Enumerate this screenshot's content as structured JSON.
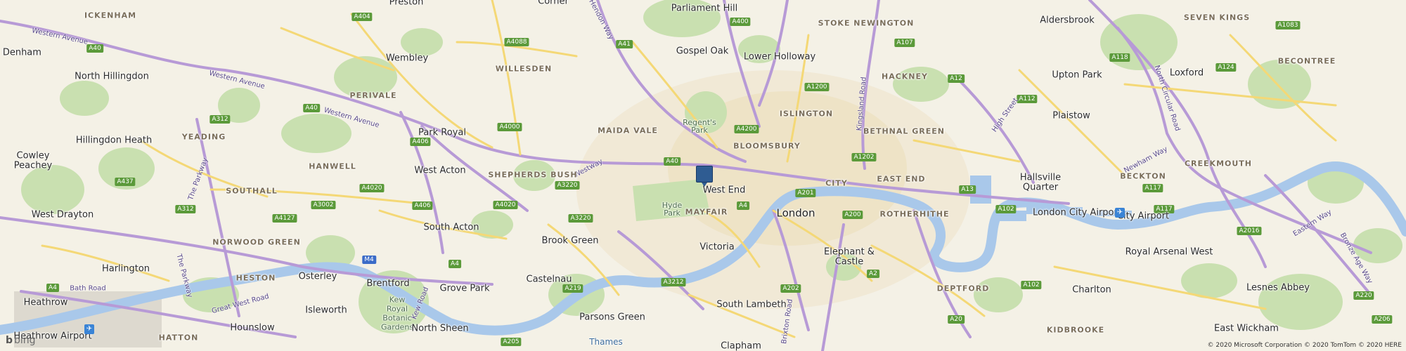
{
  "map": {
    "pin_label": "West End",
    "places": [
      {
        "id": "ickenham",
        "text": "ICKENHAM",
        "kind": "district"
      },
      {
        "id": "preston",
        "text": "Preston",
        "kind": "town"
      },
      {
        "id": "parliament-hill",
        "text": "Parliament Hill",
        "kind": "town"
      },
      {
        "id": "stoke-newington",
        "text": "STOKE NEWINGTON",
        "kind": "district"
      },
      {
        "id": "aldersbrook",
        "text": "Aldersbrook",
        "kind": "town"
      },
      {
        "id": "seven-kings",
        "text": "SEVEN KINGS",
        "kind": "district"
      },
      {
        "id": "new-denham",
        "text": "ew Denham",
        "kind": "town"
      },
      {
        "id": "north-hillingdon",
        "text": "North Hillingdon",
        "kind": "town"
      },
      {
        "id": "wembley",
        "text": "Wembley",
        "kind": "town"
      },
      {
        "id": "willesden",
        "text": "WILLESDEN",
        "kind": "district"
      },
      {
        "id": "gospel-oak",
        "text": "Gospel Oak",
        "kind": "town"
      },
      {
        "id": "lower-holloway",
        "text": "Lower Holloway",
        "kind": "town"
      },
      {
        "id": "hackney",
        "text": "HACKNEY",
        "kind": "district"
      },
      {
        "id": "upton-park",
        "text": "Upton Park",
        "kind": "town"
      },
      {
        "id": "loxford",
        "text": "Loxford",
        "kind": "town"
      },
      {
        "id": "becontree",
        "text": "BECONTREE",
        "kind": "district"
      },
      {
        "id": "perivale",
        "text": "PERIVALE",
        "kind": "district"
      },
      {
        "id": "islington",
        "text": "ISLINGTON",
        "kind": "district"
      },
      {
        "id": "plaistow",
        "text": "Plaistow",
        "kind": "town"
      },
      {
        "id": "maida-vale",
        "text": "MAIDA VALE",
        "kind": "district"
      },
      {
        "id": "regents-park",
        "text": "Regent's Park",
        "kind": "park"
      },
      {
        "id": "bethnal-green",
        "text": "BETHNAL GREEN",
        "kind": "district"
      },
      {
        "id": "hillingdon-heath",
        "text": "Hillingdon Heath",
        "kind": "town"
      },
      {
        "id": "yeading",
        "text": "YEADING",
        "kind": "district"
      },
      {
        "id": "park-royal",
        "text": "Park Royal",
        "kind": "town"
      },
      {
        "id": "bloomsbury",
        "text": "BLOOMSBURY",
        "kind": "district"
      },
      {
        "id": "cowley",
        "text": "Cowley",
        "kind": "town"
      },
      {
        "id": "peachey",
        "text": "Peachey",
        "kind": "town"
      },
      {
        "id": "hanwell",
        "text": "HANWELL",
        "kind": "district"
      },
      {
        "id": "west-acton",
        "text": "West Acton",
        "kind": "town"
      },
      {
        "id": "shepherds-bush",
        "text": "SHEPHERDS BUSH",
        "kind": "district"
      },
      {
        "id": "city",
        "text": "CITY",
        "kind": "district"
      },
      {
        "id": "east-end",
        "text": "EAST END",
        "kind": "district"
      },
      {
        "id": "hallsville",
        "text": "Hallsville",
        "kind": "town"
      },
      {
        "id": "quarter",
        "text": "Quarter",
        "kind": "town"
      },
      {
        "id": "creekmouth",
        "text": "CREEKMOUTH",
        "kind": "district"
      },
      {
        "id": "southall",
        "text": "SOUTHALL",
        "kind": "district"
      },
      {
        "id": "west-end",
        "text": "West End",
        "kind": "town"
      },
      {
        "id": "beckton",
        "text": "BECKTON",
        "kind": "district"
      },
      {
        "id": "west-drayton",
        "text": "West Drayton",
        "kind": "town"
      },
      {
        "id": "hyde-park",
        "text": "Hyde Park",
        "kind": "park"
      },
      {
        "id": "mayfair",
        "text": "MAYFAIR",
        "kind": "district"
      },
      {
        "id": "london",
        "text": "London",
        "kind": "major"
      },
      {
        "id": "rotherhithe",
        "text": "ROTHERHITHE",
        "kind": "district"
      },
      {
        "id": "london-city-airport",
        "text": "London City Airport",
        "kind": "town"
      },
      {
        "id": "city-airport",
        "text": "City Airport",
        "kind": "town"
      },
      {
        "id": "south-acton",
        "text": "South Acton",
        "kind": "town"
      },
      {
        "id": "norwood-green",
        "text": "NORWOOD GREEN",
        "kind": "district"
      },
      {
        "id": "brook-green",
        "text": "Brook Green",
        "kind": "town"
      },
      {
        "id": "victoria",
        "text": "Victoria",
        "kind": "town"
      },
      {
        "id": "elephant-castle",
        "text": "Elephant &",
        "kind": "town"
      },
      {
        "id": "castle",
        "text": "Castle",
        "kind": "town"
      },
      {
        "id": "royal-arsenal-west",
        "text": "Royal Arsenal West",
        "kind": "town"
      },
      {
        "id": "harlington",
        "text": "Harlington",
        "kind": "town"
      },
      {
        "id": "heston",
        "text": "HESTON",
        "kind": "district"
      },
      {
        "id": "osterley",
        "text": "Osterley",
        "kind": "town"
      },
      {
        "id": "brentford",
        "text": "Brentford",
        "kind": "town"
      },
      {
        "id": "castelnau",
        "text": "Castelnau",
        "kind": "town"
      },
      {
        "id": "grove-park",
        "text": "Grove Park",
        "kind": "town"
      },
      {
        "id": "deptford",
        "text": "DEPTFORD",
        "kind": "district"
      },
      {
        "id": "charlton",
        "text": "Charlton",
        "kind": "town"
      },
      {
        "id": "lesnes-abbey",
        "text": "Lesnes Abbey",
        "kind": "town"
      },
      {
        "id": "kew",
        "text": "Kew",
        "kind": "park"
      },
      {
        "id": "royal",
        "text": "Royal",
        "kind": "park"
      },
      {
        "id": "botanic",
        "text": "Botanic",
        "kind": "park"
      },
      {
        "id": "gardens",
        "text": "Gardens",
        "kind": "park"
      },
      {
        "id": "heathrow",
        "text": "Heathrow",
        "kind": "town"
      },
      {
        "id": "isleworth",
        "text": "Isleworth",
        "kind": "town"
      },
      {
        "id": "parsons-green",
        "text": "Parsons Green",
        "kind": "town"
      },
      {
        "id": "south-lambeth",
        "text": "South Lambeth",
        "kind": "town"
      },
      {
        "id": "hounslow",
        "text": "Hounslow",
        "kind": "town"
      },
      {
        "id": "north-sheen",
        "text": "North Sheen",
        "kind": "town"
      },
      {
        "id": "heathrow-airport",
        "text": "Heathrow Airport",
        "kind": "town"
      },
      {
        "id": "hatton",
        "text": "HATTON",
        "kind": "district"
      },
      {
        "id": "thames",
        "text": "Thames",
        "kind": "water"
      },
      {
        "id": "clapham",
        "text": "Clapham",
        "kind": "town"
      },
      {
        "id": "kidbrooke",
        "text": "KIDBROOKE",
        "kind": "district"
      },
      {
        "id": "east-wickham",
        "text": "East Wickham",
        "kind": "town"
      },
      {
        "id": "corner",
        "text": "Corner",
        "kind": "town"
      }
    ],
    "roads": [
      {
        "id": "a404",
        "text": "A404",
        "kind": "a"
      },
      {
        "id": "a40-1",
        "text": "A40",
        "kind": "a"
      },
      {
        "id": "a4088",
        "text": "A4088",
        "kind": "a"
      },
      {
        "id": "a41",
        "text": "A41",
        "kind": "a"
      },
      {
        "id": "a400",
        "text": "A400",
        "kind": "a"
      },
      {
        "id": "a107",
        "text": "A107",
        "kind": "a"
      },
      {
        "id": "a1083",
        "text": "A1083",
        "kind": "a"
      },
      {
        "id": "a118",
        "text": "A118",
        "kind": "a"
      },
      {
        "id": "a124",
        "text": "A124",
        "kind": "a"
      },
      {
        "id": "a12",
        "text": "A12",
        "kind": "a"
      },
      {
        "id": "a1200",
        "text": "A1200",
        "kind": "a"
      },
      {
        "id": "a112",
        "text": "A112",
        "kind": "a"
      },
      {
        "id": "a40-2",
        "text": "A40",
        "kind": "a"
      },
      {
        "id": "a312",
        "text": "A312",
        "kind": "a"
      },
      {
        "id": "a4000",
        "text": "A4000",
        "kind": "a"
      },
      {
        "id": "a4200",
        "text": "A4200",
        "kind": "a"
      },
      {
        "id": "a406",
        "text": "A406",
        "kind": "a"
      },
      {
        "id": "a1202",
        "text": "A1202",
        "kind": "a"
      },
      {
        "id": "a40-3",
        "text": "A40",
        "kind": "a"
      },
      {
        "id": "a437",
        "text": "A437",
        "kind": "a"
      },
      {
        "id": "a4020-1",
        "text": "A4020",
        "kind": "a"
      },
      {
        "id": "a3220-1",
        "text": "A3220",
        "kind": "a"
      },
      {
        "id": "a201",
        "text": "A201",
        "kind": "a"
      },
      {
        "id": "a13",
        "text": "A13",
        "kind": "a"
      },
      {
        "id": "a117",
        "text": "A117",
        "kind": "a"
      },
      {
        "id": "a3002",
        "text": "A3002",
        "kind": "a"
      },
      {
        "id": "a406-2",
        "text": "A406",
        "kind": "a"
      },
      {
        "id": "a4020-2",
        "text": "A4020",
        "kind": "a"
      },
      {
        "id": "a4",
        "text": "A4",
        "kind": "a"
      },
      {
        "id": "a200",
        "text": "A200",
        "kind": "a"
      },
      {
        "id": "a102",
        "text": "A102",
        "kind": "a"
      },
      {
        "id": "a117-2",
        "text": "A117",
        "kind": "a"
      },
      {
        "id": "a312-2",
        "text": "A312",
        "kind": "a"
      },
      {
        "id": "a4127",
        "text": "A4127",
        "kind": "a"
      },
      {
        "id": "a3220-2",
        "text": "A3220",
        "kind": "a"
      },
      {
        "id": "a2016",
        "text": "A2016",
        "kind": "a"
      },
      {
        "id": "m4",
        "text": "M4",
        "kind": "m"
      },
      {
        "id": "a4-2",
        "text": "A4",
        "kind": "a"
      },
      {
        "id": "a3212",
        "text": "A3212",
        "kind": "a"
      },
      {
        "id": "a2",
        "text": "A2",
        "kind": "a"
      },
      {
        "id": "a219",
        "text": "A219",
        "kind": "a"
      },
      {
        "id": "a202",
        "text": "A202",
        "kind": "a"
      },
      {
        "id": "a102-2",
        "text": "A102",
        "kind": "a"
      },
      {
        "id": "a4-3",
        "text": "A4",
        "kind": "a"
      },
      {
        "id": "a20",
        "text": "A20",
        "kind": "a"
      },
      {
        "id": "a206",
        "text": "A206",
        "kind": "a"
      },
      {
        "id": "a205",
        "text": "A205",
        "kind": "a"
      },
      {
        "id": "a220",
        "text": "A220",
        "kind": "a"
      }
    ],
    "road_names": [
      {
        "id": "western-avenue-1",
        "text": "Western Avenue"
      },
      {
        "id": "western-avenue-2",
        "text": "Western Avenue"
      },
      {
        "id": "western-avenue-3",
        "text": "Western Avenue"
      },
      {
        "id": "hendon-way",
        "text": "Hendon Way"
      },
      {
        "id": "kingsland-road",
        "text": "Kingsland Road"
      },
      {
        "id": "north-circular-road",
        "text": "North Circular Road"
      },
      {
        "id": "high-street",
        "text": "High Street"
      },
      {
        "id": "the-parkway-1",
        "text": "The Parkway"
      },
      {
        "id": "westway",
        "text": "Westway"
      },
      {
        "id": "newham-way",
        "text": "Newham Way"
      },
      {
        "id": "eastern-way",
        "text": "Eastern Way"
      },
      {
        "id": "bronze-age-way",
        "text": "Bronze Age Way"
      },
      {
        "id": "the-parkway-2",
        "text": "The Parkway"
      },
      {
        "id": "bath-road",
        "text": "Bath Road"
      },
      {
        "id": "great-west-road",
        "text": "Great West Road"
      },
      {
        "id": "kew-road",
        "text": "Kew Road"
      },
      {
        "id": "brixton-road",
        "text": "Brixton Road"
      }
    ],
    "attribution": {
      "logo_text": "bing",
      "copyright": "© 2020 Microsoft Corporation © 2020 TomTom © 2020 HERE"
    },
    "colors": {
      "land": "#f4f1e6",
      "park": "#c9e0b0",
      "water": "#a9c8ea",
      "major_road": "#b79ad6",
      "minor_road": "#f4d876",
      "pin": "#2f5c92"
    }
  }
}
